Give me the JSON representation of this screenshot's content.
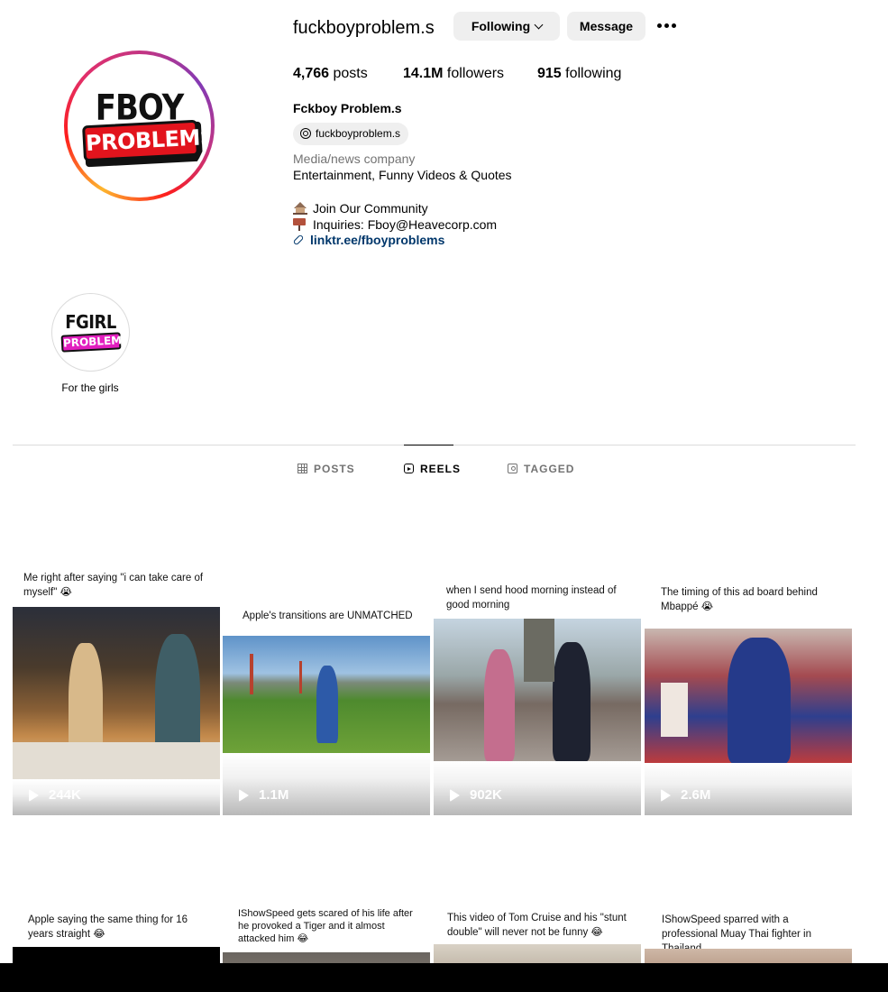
{
  "profile": {
    "username": "fuckboyproblem.s",
    "following_button": "Following",
    "message_button": "Message",
    "avatar_logo_top": "FBOY",
    "avatar_logo_bottom": "PROBLEMS",
    "stats": {
      "posts_count": "4,766",
      "posts_label": "posts",
      "followers_count": "14.1M",
      "followers_label": "followers",
      "following_count": "915",
      "following_label": "following"
    },
    "full_name": "Fckboy Problem.s",
    "threads_handle": "fuckboyproblem.s",
    "category": "Media/news company",
    "bio": [
      "Entertainment, Funny Videos & Quotes",
      "Join Our Community",
      "Inquiries: Fboy@Heavecorp.com"
    ],
    "link": "linktr.ee/fboyproblems"
  },
  "highlight": {
    "logo_top": "FGIRL",
    "logo_bottom": "PROBLEMS",
    "label": "For the girls"
  },
  "tabs": [
    {
      "label": "POSTS",
      "icon": "grid-icon",
      "active": false
    },
    {
      "label": "REELS",
      "icon": "reels-icon",
      "active": true
    },
    {
      "label": "TAGGED",
      "icon": "tag-icon",
      "active": false
    }
  ],
  "reels": [
    {
      "caption": "Me right after saying \"i can take care of myself\" 😭",
      "views": "244K"
    },
    {
      "caption": "Apple's transitions are UNMATCHED",
      "views": "1.1M"
    },
    {
      "caption": "when I send hood morning instead of good morning",
      "views": "902K"
    },
    {
      "caption": "The timing of this ad board behind Mbappé 😭",
      "views": "2.6M"
    },
    {
      "caption": "Apple saying the same thing for 16 years straight 😂",
      "views": ""
    },
    {
      "caption": "IShowSpeed gets scared of his life after he provoked a Tiger and it almost attacked him 😂",
      "views": ""
    },
    {
      "caption": "This video of Tom Cruise and his \"stunt double\" will never not be funny 😂",
      "views": ""
    },
    {
      "caption": "IShowSpeed sparred with a professional Muay Thai fighter in Thailand",
      "views": ""
    }
  ]
}
